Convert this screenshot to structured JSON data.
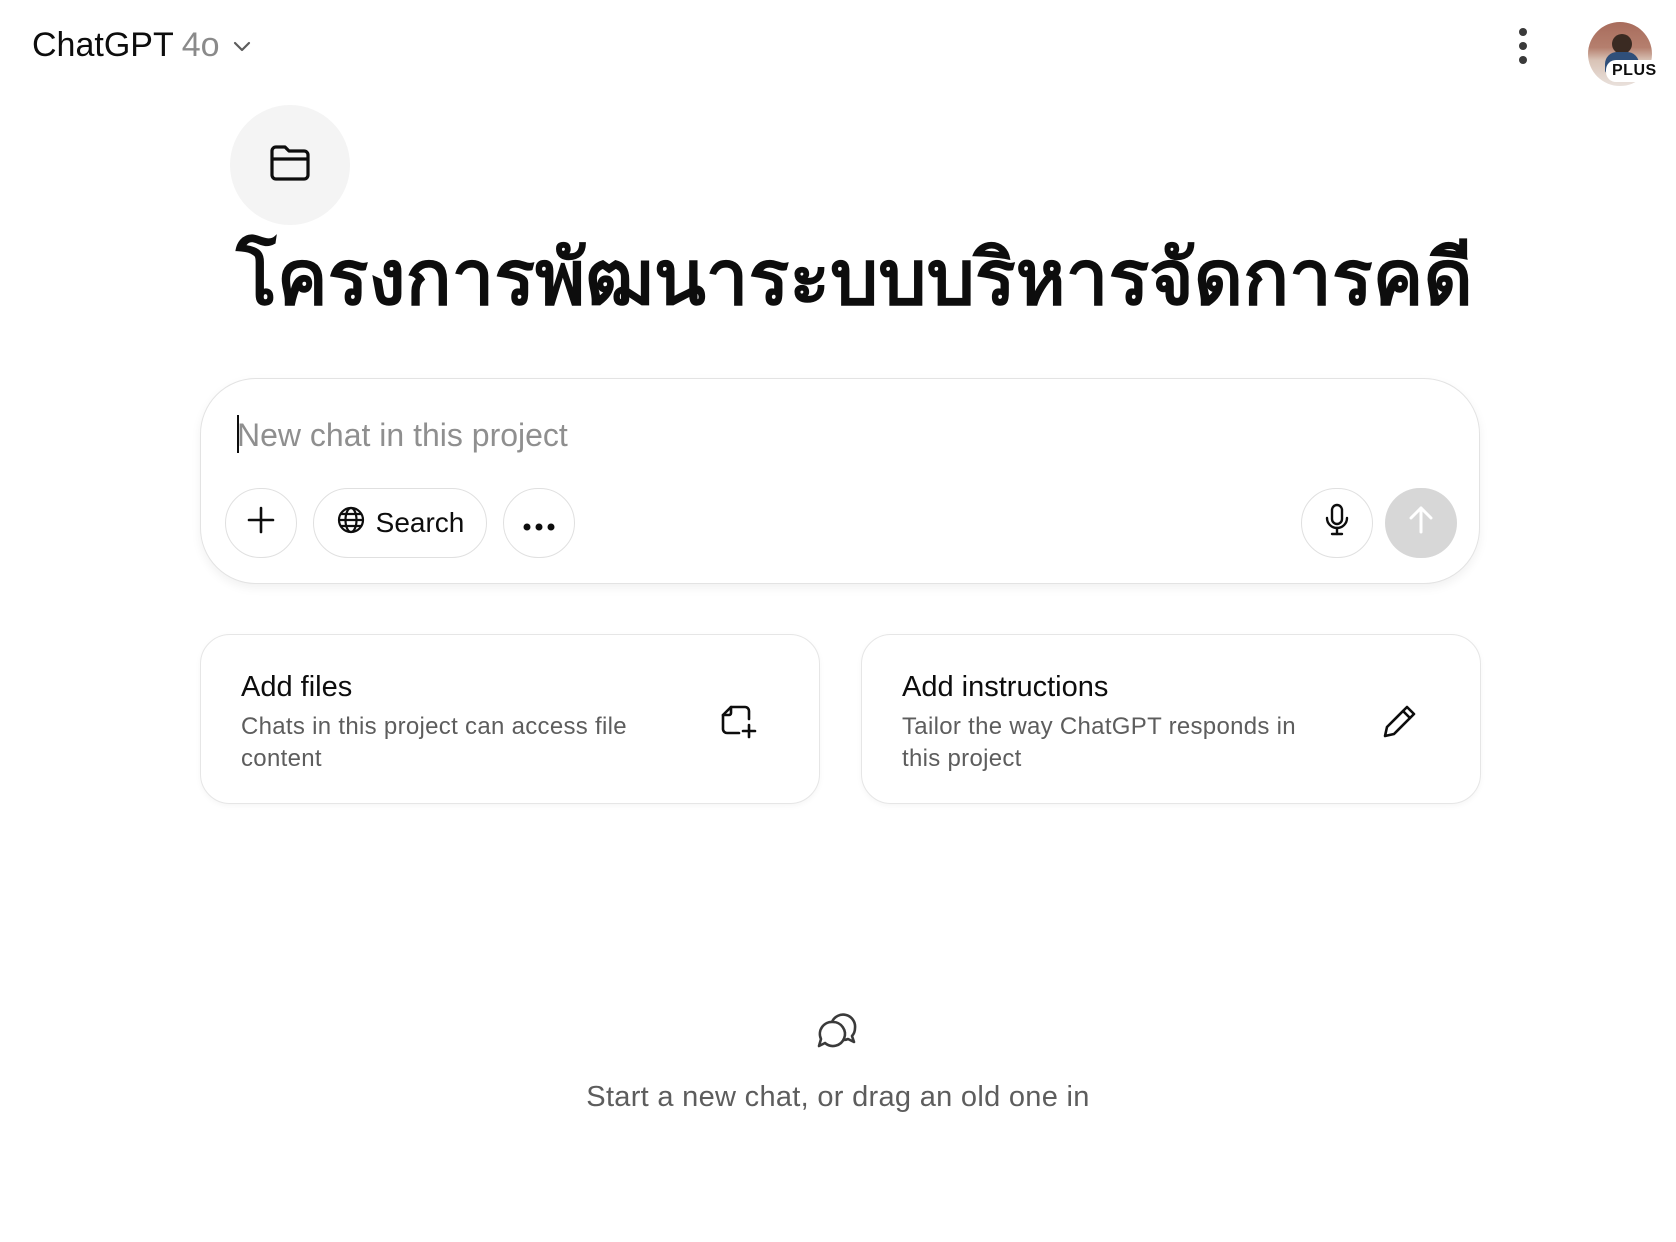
{
  "header": {
    "model_name": "ChatGPT",
    "model_version": "4o",
    "plan_badge": "PLUS",
    "icons": {
      "model_dropdown": "chevron-down-icon",
      "menu": "more-vertical-icon"
    }
  },
  "project": {
    "icon": "folder-icon",
    "title": "โครงการพัฒนาระบบบริหารจัดการคดี"
  },
  "composer": {
    "placeholder": "New chat in this project",
    "value": "",
    "search_label": "Search",
    "icons": {
      "attach": "plus-icon",
      "search": "globe-icon",
      "tools": "more-horizontal-icon",
      "voice": "microphone-icon",
      "send": "arrow-up-icon"
    },
    "send_disabled_color": "#d7d7d7"
  },
  "cards": [
    {
      "title": "Add files",
      "description": "Chats in this project can access file content",
      "icon": "file-add-icon"
    },
    {
      "title": "Add instructions",
      "description": "Tailor the way ChatGPT responds in this project",
      "icon": "pencil-icon"
    }
  ],
  "empty_state": {
    "icon": "chat-bubbles-icon",
    "text": "Start a new chat, or drag an old one in"
  }
}
